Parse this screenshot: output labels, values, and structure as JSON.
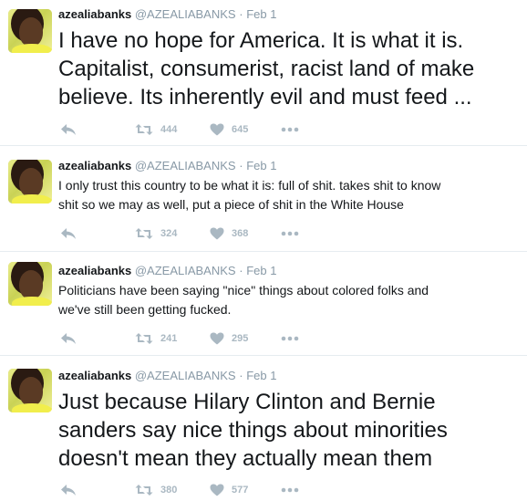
{
  "tweets": [
    {
      "name": "azealiabanks",
      "handle": "@AZEALIABANKS",
      "separator": "·",
      "date": "Feb 1",
      "lines": [
        "I have no hope for America. It is what it is.",
        "Capitalist, consumerist, racist land of make",
        "believe. Its inherently evil and must feed ..."
      ],
      "retweets": "444",
      "likes": "645"
    },
    {
      "name": "azealiabanks",
      "handle": "@AZEALIABANKS",
      "separator": "·",
      "date": "Feb 1",
      "lines": [
        "I only trust this country to be what it is: full of shit. takes shit to know",
        "shit so we may as well, put a piece of shit in the White House"
      ],
      "retweets": "324",
      "likes": "368"
    },
    {
      "name": "azealiabanks",
      "handle": "@AZEALIABANKS",
      "separator": "·",
      "date": "Feb 1",
      "lines": [
        "Politicians have been saying \"nice\" things about colored folks and",
        "we've still been getting fucked."
      ],
      "retweets": "241",
      "likes": "295"
    },
    {
      "name": "azealiabanks",
      "handle": "@AZEALIABANKS",
      "separator": "·",
      "date": "Feb 1",
      "lines": [
        "Just because Hilary Clinton and Bernie",
        "sanders say nice things about minorities",
        "doesn't mean they actually mean them"
      ],
      "retweets": "380",
      "likes": "577"
    }
  ],
  "icons": {
    "reply": "reply-arrow-icon",
    "retweet": "retweet-icon",
    "like": "heart-icon",
    "more": "more-dots-icon"
  },
  "colors": {
    "text": "#14171a",
    "meta": "#8899a6",
    "action": "#aab8c2",
    "divider": "#e6ecf0"
  }
}
